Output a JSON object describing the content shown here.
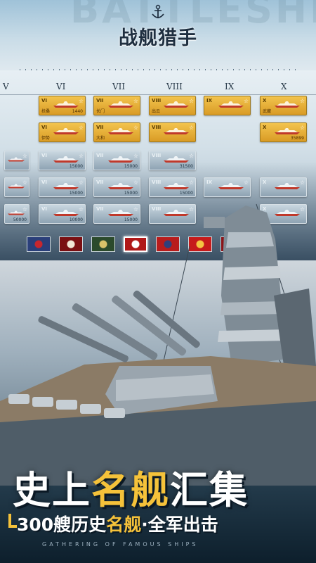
{
  "app": {
    "logo_text": "战舰猎手",
    "watermark": "BATTLESHIP"
  },
  "tree": {
    "tiers": [
      "V",
      "VI",
      "VII",
      "VIII",
      "IX",
      "X"
    ],
    "rows": [
      [
        {
          "col": 1,
          "tier": "VI",
          "name": "扶桑",
          "cost": "1440",
          "style": "gold"
        },
        {
          "col": 2,
          "tier": "VII",
          "name": "长门",
          "cost": "",
          "style": "gold"
        },
        {
          "col": 3,
          "tier": "VIII",
          "name": "出云",
          "cost": "",
          "style": "gold"
        },
        {
          "col": 4,
          "tier": "IX",
          "name": "",
          "cost": "",
          "style": "gold"
        },
        {
          "col": 5,
          "tier": "X",
          "name": "武藏",
          "cost": "",
          "style": "gold"
        }
      ],
      [
        {
          "col": 1,
          "tier": "VI",
          "name": "伊势",
          "cost": "",
          "style": "gold"
        },
        {
          "col": 2,
          "tier": "VII",
          "name": "大和",
          "cost": "",
          "style": "gold"
        },
        {
          "col": 3,
          "tier": "VIII",
          "name": "",
          "cost": "",
          "style": "gold"
        },
        {
          "col": 5,
          "tier": "X",
          "name": "",
          "cost": "35899",
          "style": "gold"
        }
      ],
      [
        {
          "col": 0,
          "tier": "",
          "name": "",
          "cost": "",
          "style": "grey"
        },
        {
          "col": 1,
          "tier": "VI",
          "name": "",
          "cost": "15000",
          "style": "grey"
        },
        {
          "col": 2,
          "tier": "VII",
          "name": "",
          "cost": "15000",
          "style": "grey"
        },
        {
          "col": 3,
          "tier": "VIII",
          "name": "",
          "cost": "31500",
          "style": "grey"
        }
      ],
      [
        {
          "col": 0,
          "tier": "",
          "name": "",
          "cost": "",
          "style": "grey"
        },
        {
          "col": 1,
          "tier": "VI",
          "name": "",
          "cost": "15000",
          "style": "grey"
        },
        {
          "col": 2,
          "tier": "VII",
          "name": "",
          "cost": "15000",
          "style": "grey"
        },
        {
          "col": 3,
          "tier": "VIII",
          "name": "",
          "cost": "15000",
          "style": "grey"
        },
        {
          "col": 4,
          "tier": "IX",
          "name": "",
          "cost": "",
          "style": "grey"
        },
        {
          "col": 5,
          "tier": "X",
          "name": "",
          "cost": "",
          "style": "grey"
        }
      ],
      [
        {
          "col": 0,
          "tier": "",
          "name": "",
          "cost": "50000",
          "style": "grey"
        },
        {
          "col": 1,
          "tier": "VI",
          "name": "",
          "cost": "10000",
          "style": "grey"
        },
        {
          "col": 2,
          "tier": "VII",
          "name": "",
          "cost": "15000",
          "style": "grey"
        },
        {
          "col": 3,
          "tier": "VIII",
          "name": "",
          "cost": "",
          "style": "grey"
        },
        {
          "col": 5,
          "tier": "X",
          "name": "",
          "cost": "",
          "style": "grey"
        }
      ]
    ],
    "nations": [
      {
        "name": "usa",
        "color": "#2a3f7a",
        "accent": "#c8262e",
        "selected": false
      },
      {
        "name": "germany",
        "color": "#7a0f12",
        "accent": "#f1e6d6",
        "selected": false
      },
      {
        "name": "soviet",
        "color": "#2b4a2c",
        "accent": "#d9c26a",
        "selected": false
      },
      {
        "name": "japan",
        "color": "#b01818",
        "accent": "#ffffff",
        "selected": true
      },
      {
        "name": "uk",
        "color": "#b81c1c",
        "accent": "#2f3f7c",
        "selected": false
      },
      {
        "name": "china",
        "color": "#c61b1b",
        "accent": "#f4c542",
        "selected": false
      },
      {
        "name": "france",
        "color": "#8a1519",
        "accent": "#f2d7a5",
        "selected": false
      }
    ]
  },
  "promo": {
    "headline_a": "史上",
    "headline_b": "名舰",
    "headline_c": "汇集",
    "sub_a": "300艘历史",
    "sub_b": "名舰",
    "sub_c": "·全军出击",
    "english": "GATHERING OF FAMOUS SHIPS"
  },
  "colors": {
    "gold_card": "#e3a72f",
    "grey_card": "#a9bac6",
    "highlight": "#f5c23a"
  }
}
